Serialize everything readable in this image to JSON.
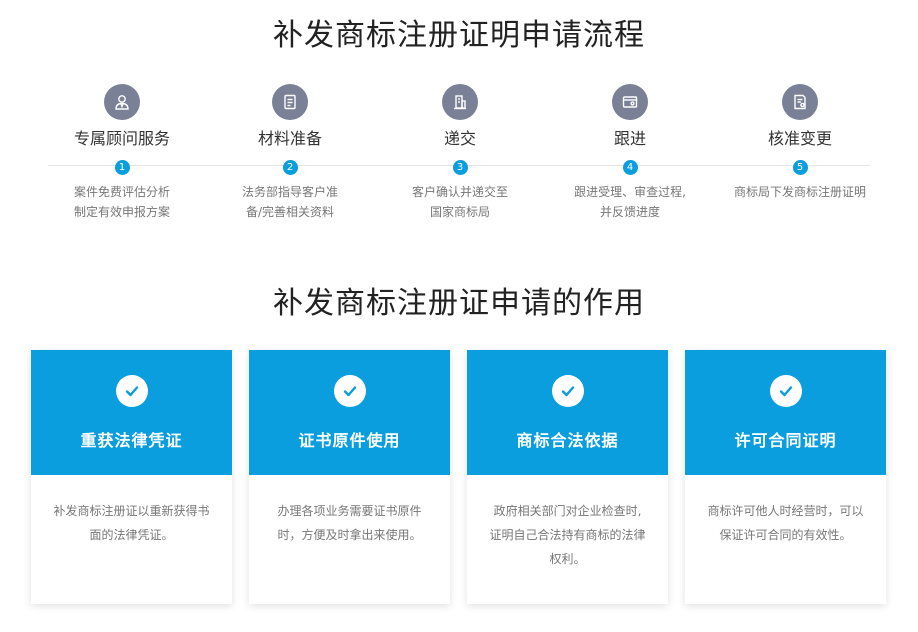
{
  "process": {
    "title": "补发商标注册证明申请流程",
    "steps": [
      {
        "icon": "advisor-icon",
        "name": "专属顾问服务",
        "num": "1",
        "desc_line1": "案件免费评估分析",
        "desc_line2": "制定有效申报方案"
      },
      {
        "icon": "document-prep-icon",
        "name": "材料准备",
        "num": "2",
        "desc_line1": "法务部指导客户准",
        "desc_line2": "备/完善相关资料"
      },
      {
        "icon": "submit-building-icon",
        "name": "递交",
        "num": "3",
        "desc_line1": "客户确认并递交至",
        "desc_line2": "国家商标局"
      },
      {
        "icon": "tracking-card-icon",
        "name": "跟进",
        "num": "4",
        "desc_line1": "跟进受理、审查过程,",
        "desc_line2": "并反馈进度"
      },
      {
        "icon": "approval-document-icon",
        "name": "核准变更",
        "num": "5",
        "desc_line1": "商标局下发商标注册证明",
        "desc_line2": ""
      }
    ]
  },
  "benefits": {
    "title": "补发商标注册证申请的作用",
    "cards": [
      {
        "title": "重获法律凭证",
        "desc_line1": "补发商标注册证以重新获得书",
        "desc_line2": "面的法律凭证。",
        "desc_line3": ""
      },
      {
        "title": "证书原件使用",
        "desc_line1": "办理各项业务需要证书原件",
        "desc_line2": "时，方便及时拿出来使用。",
        "desc_line3": ""
      },
      {
        "title": "商标合法依据",
        "desc_line1": "政府相关部门对企业检查时,",
        "desc_line2": "证明自己合法持有商标的法律",
        "desc_line3": "权利。"
      },
      {
        "title": "许可合同证明",
        "desc_line1": "商标许可他人时经营时，可以",
        "desc_line2": "保证许可合同的有效性。",
        "desc_line3": ""
      }
    ]
  },
  "colors": {
    "accent": "#0a9edf",
    "icon_bg": "#7a8196"
  }
}
